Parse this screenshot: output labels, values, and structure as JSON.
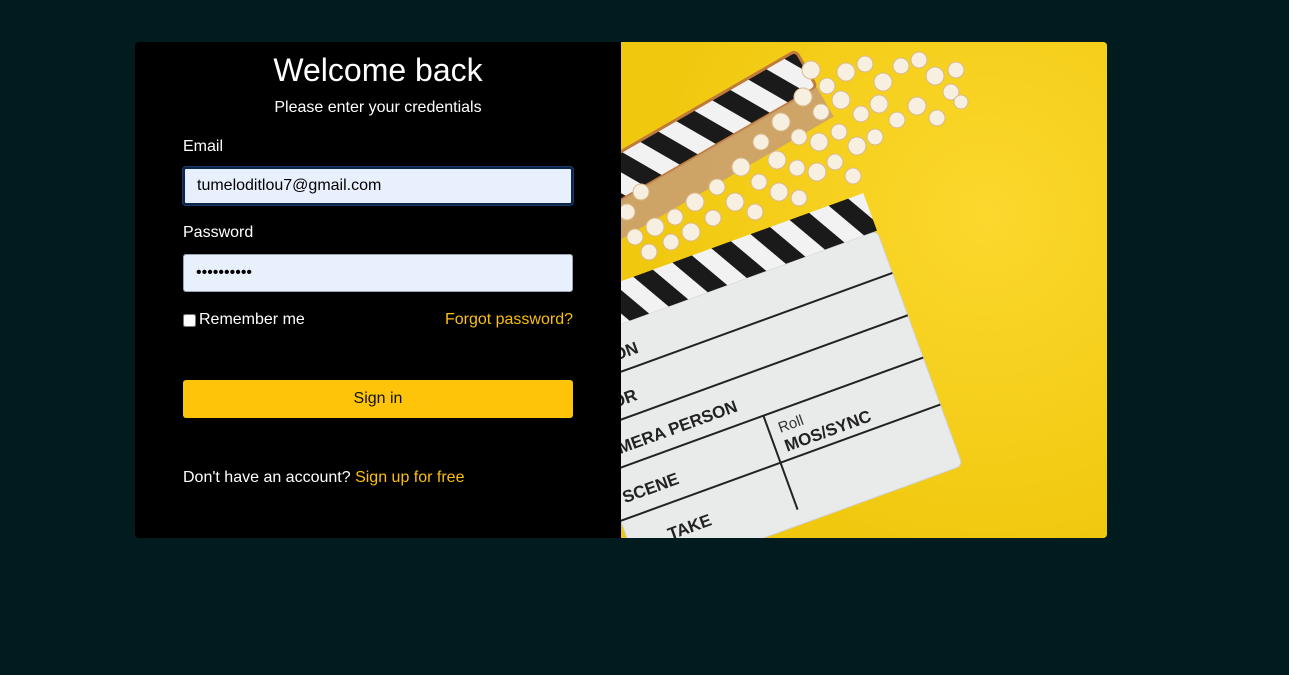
{
  "login": {
    "title": "Welcome back",
    "subtitle": "Please enter your credentials",
    "email_label": "Email",
    "email_value": "tumeloditlou7@gmail.com",
    "password_label": "Password",
    "password_value": "••••••••••",
    "remember_label": "Remember me",
    "forgot_label": "Forgot password?",
    "signin_label": "Sign in",
    "no_account_text": "Don't have an account?",
    "signup_label": "Sign up for free"
  },
  "hero": {
    "slate_lines": [
      "ACTION",
      "CTOR",
      "AMERA PERSON",
      "Roll",
      "SCENE",
      "MOS/SYNC",
      "TAKE"
    ]
  },
  "colors": {
    "page_bg": "#011b1e",
    "panel_bg": "#000000",
    "accent": "#fdc40a",
    "hero_bg": "#f4cc14",
    "input_bg": "#e8f0fe"
  }
}
